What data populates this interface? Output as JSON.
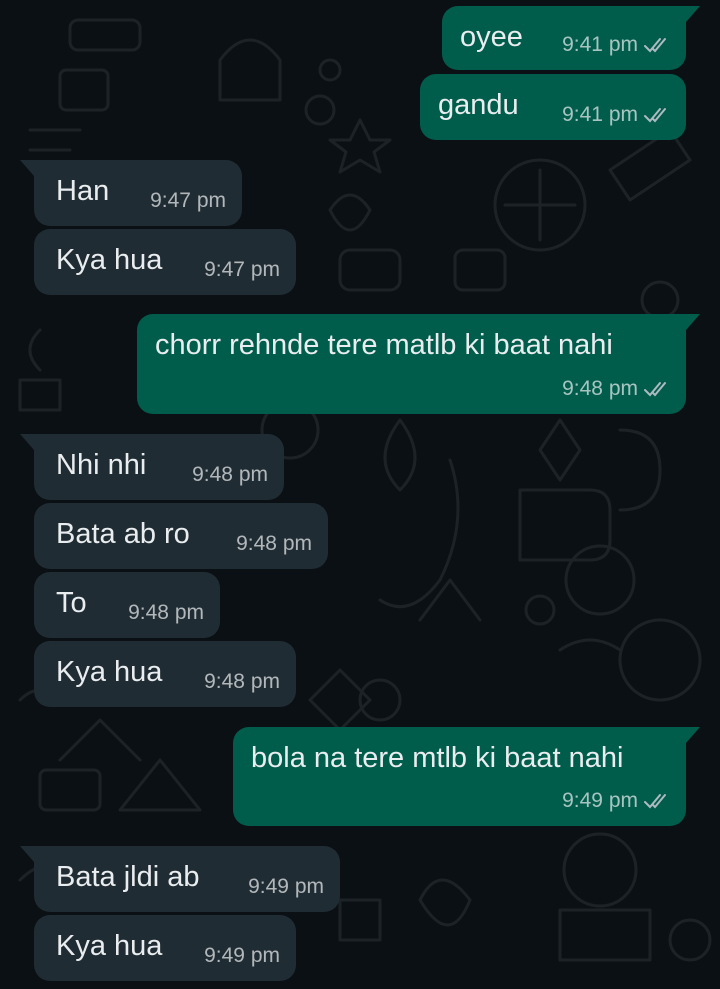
{
  "chat": {
    "messages": [
      {
        "id": "m1",
        "dir": "out",
        "text": "oyee",
        "time": "9:41 pm",
        "status": "read"
      },
      {
        "id": "m2",
        "dir": "out",
        "text": "gandu",
        "time": "9:41 pm",
        "status": "read"
      },
      {
        "id": "m3",
        "dir": "in",
        "text": "Han",
        "time": "9:47 pm"
      },
      {
        "id": "m4",
        "dir": "in",
        "text": "Kya hua",
        "time": "9:47 pm"
      },
      {
        "id": "m5",
        "dir": "out",
        "text": "chorr rehnde tere matlb ki baat nahi",
        "time": "9:48 pm",
        "status": "read"
      },
      {
        "id": "m6",
        "dir": "in",
        "text": "Nhi nhi",
        "time": "9:48 pm"
      },
      {
        "id": "m7",
        "dir": "in",
        "text": "Bata ab ro",
        "time": "9:48 pm"
      },
      {
        "id": "m8",
        "dir": "in",
        "text": "To",
        "time": "9:48 pm"
      },
      {
        "id": "m9",
        "dir": "in",
        "text": "Kya hua",
        "time": "9:48 pm"
      },
      {
        "id": "m10",
        "dir": "out",
        "text": "bola na tere mtlb ki baat nahi",
        "time": "9:49 pm",
        "status": "read"
      },
      {
        "id": "m11",
        "dir": "in",
        "text": "Bata jldi ab",
        "time": "9:49 pm"
      },
      {
        "id": "m12",
        "dir": "in",
        "text": "Kya hua",
        "time": "9:49 pm"
      }
    ]
  },
  "colors": {
    "background": "#0b1014",
    "incoming_bubble": "#202c33",
    "outgoing_bubble": "#005c4b",
    "text": "#e9edef",
    "meta": "#aebac1",
    "read_ticks": "#aebac1"
  },
  "icons": {
    "read_receipt": "double-check-icon"
  }
}
